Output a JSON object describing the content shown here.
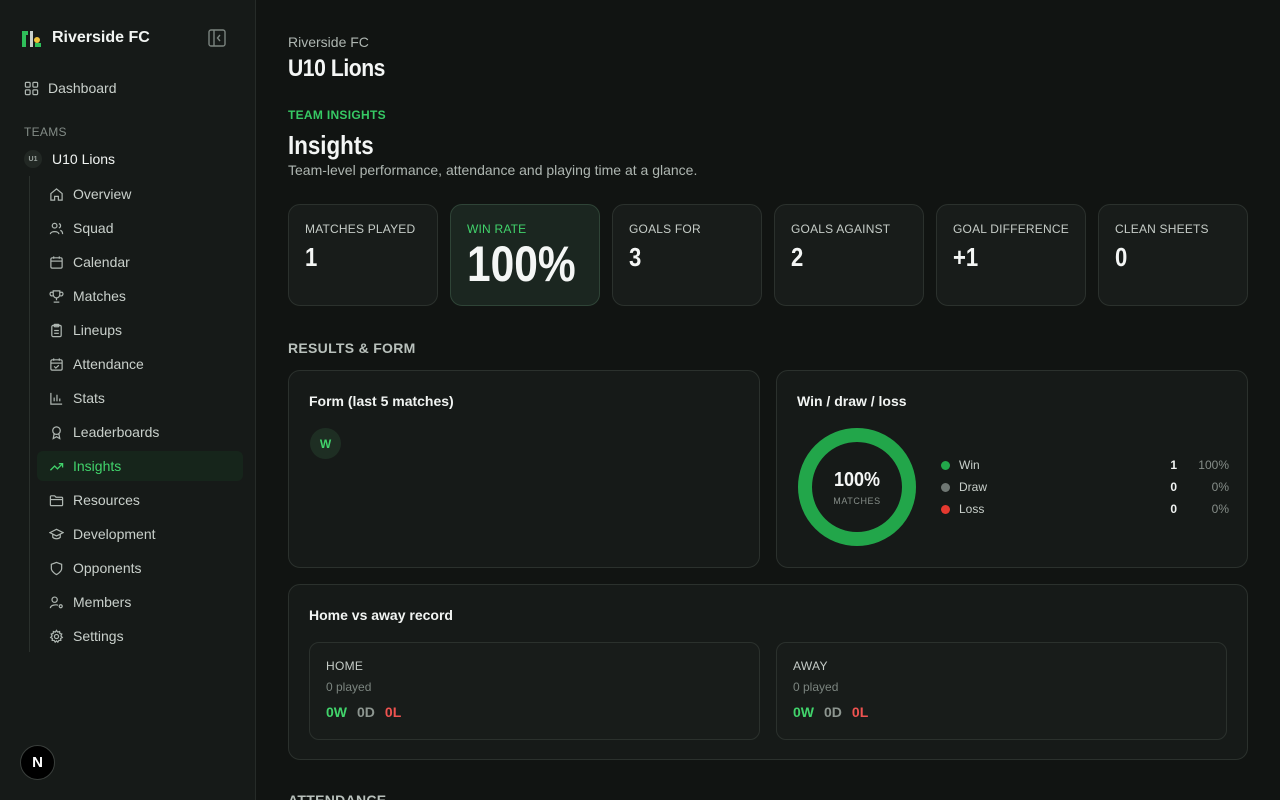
{
  "sidebar": {
    "brand": "Riverside FC",
    "dashboard": "Dashboard",
    "teams_label": "TEAMS",
    "team": {
      "badge": "U1",
      "name": "U10 Lions"
    },
    "items": [
      {
        "label": "Overview",
        "icon": "home-icon"
      },
      {
        "label": "Squad",
        "icon": "users-icon"
      },
      {
        "label": "Calendar",
        "icon": "calendar-icon"
      },
      {
        "label": "Matches",
        "icon": "trophy-icon"
      },
      {
        "label": "Lineups",
        "icon": "clipboard-icon"
      },
      {
        "label": "Attendance",
        "icon": "calendar-check-icon"
      },
      {
        "label": "Stats",
        "icon": "bar-chart-icon"
      },
      {
        "label": "Leaderboards",
        "icon": "award-icon"
      },
      {
        "label": "Insights",
        "icon": "trending-up-icon",
        "active": true
      },
      {
        "label": "Resources",
        "icon": "folder-icon"
      },
      {
        "label": "Development",
        "icon": "graduation-cap-icon"
      },
      {
        "label": "Opponents",
        "icon": "shield-icon"
      },
      {
        "label": "Members",
        "icon": "user-cog-icon"
      },
      {
        "label": "Settings",
        "icon": "gear-icon"
      }
    ],
    "avatar_letter": "N"
  },
  "header": {
    "club": "Riverside FC",
    "team": "U10 Lions",
    "eyebrow": "TEAM INSIGHTS",
    "title": "Insights",
    "description": "Team-level performance, attendance and playing time at a glance."
  },
  "stats": [
    {
      "label": "MATCHES PLAYED",
      "value": "1"
    },
    {
      "label": "WIN RATE",
      "value": "100%"
    },
    {
      "label": "GOALS FOR",
      "value": "3"
    },
    {
      "label": "GOALS AGAINST",
      "value": "2"
    },
    {
      "label": "GOAL DIFFERENCE",
      "value": "+1"
    },
    {
      "label": "CLEAN SHEETS",
      "value": "0"
    }
  ],
  "results_section": "RESULTS & FORM",
  "form": {
    "title": "Form (last 5 matches)",
    "results": [
      "W"
    ]
  },
  "wdl": {
    "title": "Win / draw / loss",
    "center_pct": "100%",
    "center_caption": "MATCHES",
    "rows": [
      {
        "name": "Win",
        "count": "1",
        "pct": "100%",
        "color": "#22a64a",
        "fraction": 1.0
      },
      {
        "name": "Draw",
        "count": "0",
        "pct": "0%",
        "color": "#6f7773",
        "fraction": 0
      },
      {
        "name": "Loss",
        "count": "0",
        "pct": "0%",
        "color": "#e5392f",
        "fraction": 0
      }
    ]
  },
  "home_away": {
    "title": "Home vs away record",
    "home": {
      "label": "HOME",
      "played": "0 played",
      "w": "0W",
      "d": "0D",
      "l": "0L"
    },
    "away": {
      "label": "AWAY",
      "played": "0 played",
      "w": "0W",
      "d": "0D",
      "l": "0L"
    }
  },
  "next_section": "ATTENDANCE"
}
